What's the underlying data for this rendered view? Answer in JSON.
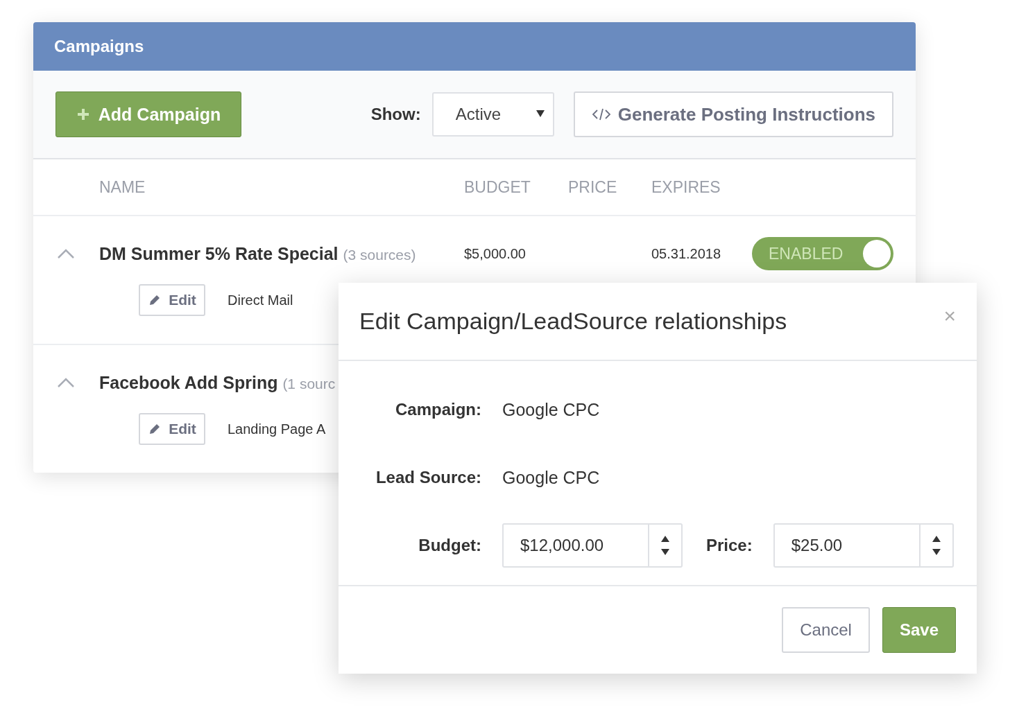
{
  "panel": {
    "title": "Campaigns"
  },
  "toolbar": {
    "add_button": "Add Campaign",
    "show_label": "Show:",
    "show_value": "Active",
    "generate_button": "Generate Posting Instructions"
  },
  "table": {
    "columns": [
      "NAME",
      "BUDGET",
      "PRICE",
      "EXPIRES"
    ],
    "rows": [
      {
        "name": "DM Summer 5% Rate Special",
        "sources": "(3 sources)",
        "budget": "$5,000.00",
        "price": "",
        "expires": "05.31.2018",
        "status": "ENABLED",
        "enabled": true,
        "expanded": true,
        "children": [
          {
            "button": "Edit",
            "source": "Direct Mail"
          }
        ]
      },
      {
        "name": "Facebook Add Spring",
        "sources": "(1 sourc",
        "expanded": true,
        "children": [
          {
            "button": "Edit",
            "source": "Landing Page A"
          }
        ]
      }
    ]
  },
  "modal": {
    "title": "Edit Campaign/LeadSource relationships",
    "close": "×",
    "fields": [
      {
        "kind": "text",
        "label": "Campaign:",
        "value": "Google CPC"
      },
      {
        "kind": "text",
        "label": "Lead Source:",
        "value": "Google CPC"
      },
      {
        "kind": "numbers",
        "items": [
          {
            "label": "Budget:",
            "value": "$12,000.00"
          },
          {
            "label": "Price:",
            "value": "$25.00"
          }
        ]
      }
    ],
    "buttons": [
      {
        "label": "Cancel",
        "kind": "secondary"
      },
      {
        "label": "Save",
        "kind": "primary"
      }
    ]
  }
}
